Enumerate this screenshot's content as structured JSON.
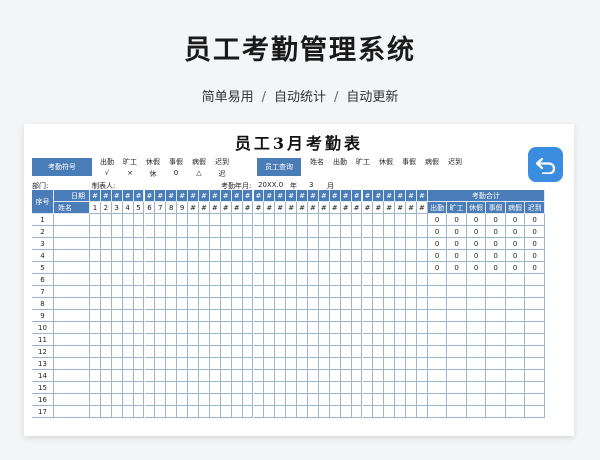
{
  "header": {
    "title": "员工考勤管理系统"
  },
  "subtitle": {
    "items": [
      "简单易用",
      "自动统计",
      "自动更新"
    ],
    "separator": "/"
  },
  "sheet": {
    "title": "员工3月考勤表",
    "symbols_label": "考勤符号",
    "symbol_names": [
      "出勤",
      "旷工",
      "休假",
      "事假",
      "病假",
      "迟到"
    ],
    "symbol_marks": [
      "√",
      "×",
      "休",
      "0",
      "△",
      "迟"
    ],
    "query_label": "员工查询",
    "query_cols": [
      "姓名",
      "出勤",
      "旷工",
      "休假",
      "事假",
      "病假",
      "迟到"
    ],
    "dept_label": "部门:",
    "creator_label": "制表人:",
    "period_label": "考勤年月:",
    "year": "20XX.0",
    "year_unit": "年",
    "month": "3",
    "month_unit": "月",
    "back_icon": "undo-icon",
    "table": {
      "seq_header": "序号",
      "date_header": "日期",
      "name_header": "姓名",
      "day_hash": "#",
      "day_numbers": [
        "1",
        "2",
        "3",
        "4",
        "5",
        "6",
        "7",
        "8",
        "9",
        "#",
        "#",
        "#",
        "#",
        "#",
        "#",
        "#",
        "#",
        "#",
        "#",
        "#",
        "#",
        "#",
        "#",
        "#",
        "#",
        "#",
        "#",
        "#",
        "#",
        "#",
        "#"
      ],
      "summary_header": "考勤合计",
      "summary_cols": [
        "出勤",
        "旷工",
        "休假",
        "事假",
        "病假",
        "迟到"
      ],
      "row_numbers": [
        "1",
        "2",
        "3",
        "4",
        "5",
        "6",
        "7",
        "8",
        "9",
        "10",
        "11",
        "12",
        "13",
        "14",
        "15",
        "16",
        "17"
      ],
      "summary_rows": [
        [
          "0",
          "0",
          "0",
          "0",
          "0",
          "0"
        ],
        [
          "0",
          "0",
          "0",
          "0",
          "0",
          "0"
        ],
        [
          "0",
          "0",
          "0",
          "0",
          "0",
          "0"
        ],
        [
          "0",
          "0",
          "0",
          "0",
          "0",
          "0"
        ],
        [
          "0",
          "0",
          "0",
          "0",
          "0",
          "0"
        ]
      ]
    }
  },
  "colors": {
    "accent": "#4a7db8",
    "button": "#3b8de0"
  }
}
